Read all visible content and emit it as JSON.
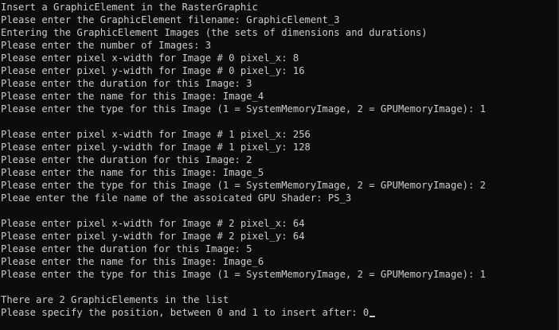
{
  "console": {
    "lines": [
      "Insert a GraphicElement in the RasterGraphic",
      "Please enter the GraphicElement filename: GraphicElement_3",
      "Entering the GraphicElement Images (the sets of dimensions and durations)",
      "Please enter the number of Images: 3",
      "Please enter pixel x-width for Image # 0 pixel_x: 8",
      "Please enter pixel y-width for Image # 0 pixel_y: 16",
      "Please enter the duration for this Image: 3",
      "Please enter the name for this Image: Image_4",
      "Please enter the type for this Image (1 = SystemMemoryImage, 2 = GPUMemoryImage): 1",
      "",
      "Please enter pixel x-width for Image # 1 pixel_x: 256",
      "Please enter pixel y-width for Image # 1 pixel_y: 128",
      "Please enter the duration for this Image: 2",
      "Please enter the name for this Image: Image_5",
      "Please enter the type for this Image (1 = SystemMemoryImage, 2 = GPUMemoryImage): 2",
      "Pleae enter the file name of the assoicated GPU Shader: PS_3",
      "",
      "Please enter pixel x-width for Image # 2 pixel_x: 64",
      "Please enter pixel y-width for Image # 2 pixel_y: 64",
      "Please enter the duration for this Image: 5",
      "Please enter the name for this Image: Image_6",
      "Please enter the type for this Image (1 = SystemMemoryImage, 2 = GPUMemoryImage): 1",
      "",
      "There are 2 GraphicElements in the list",
      "Please specify the position, between 0 and 1 to insert after: 0"
    ]
  }
}
